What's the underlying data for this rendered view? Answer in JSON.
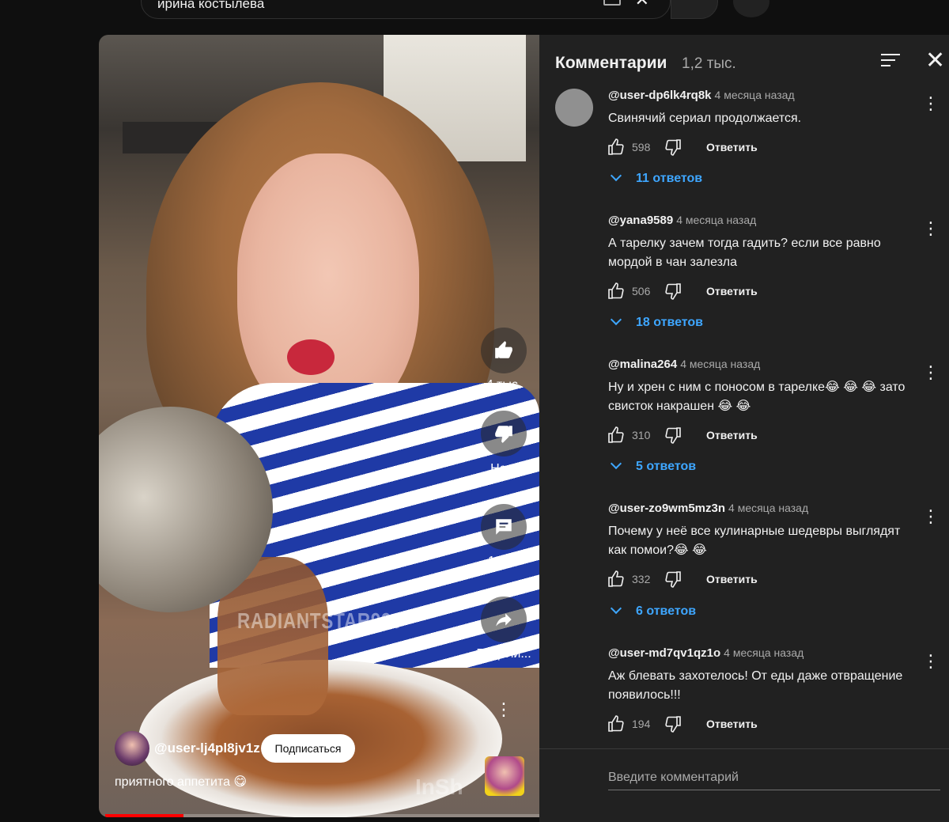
{
  "search": {
    "query": "ирина костылева"
  },
  "video": {
    "watermark": "RADIANTSTAR999",
    "watermark2": "InSh",
    "likes_label": "4 тыс.",
    "dislike_label": "Не...",
    "comments_label": "1 216",
    "share_label": "Подели...",
    "channel": "@user-lj4pl8jv1z",
    "subscribe_label": "Подписаться",
    "caption": "приятного аппетита 😋",
    "progress_fraction": 0.18
  },
  "comments_panel": {
    "title": "Комментарии",
    "count": "1,2 тыс.",
    "input_placeholder": "Введите комментарий",
    "reply_label": "Ответить",
    "items": [
      {
        "user": "@user-dp6lk4rq8k",
        "time": "4 месяца назад",
        "text": "Свинячий сериал продолжается.",
        "likes": "598",
        "replies": "11 ответов"
      },
      {
        "user": "@yana9589",
        "time": "4 месяца назад",
        "text": "А тарелку зачем тогда гадить? если все равно мордой в чан залезла",
        "likes": "506",
        "replies": "18 ответов"
      },
      {
        "user": "@malina264",
        "time": "4 месяца назад",
        "text": "Ну и хрен с ним с поносом в тарелке😂 😂 😂 зато свисток накрашен 😂 😂",
        "likes": "310",
        "replies": "5 ответов"
      },
      {
        "user": "@user-zo9wm5mz3n",
        "time": "4 месяца назад",
        "text": "Почему у неё все кулинарные шедевры выглядят как помои?😂 😂",
        "likes": "332",
        "replies": "6 ответов"
      },
      {
        "user": "@user-md7qv1qz1o",
        "time": "4 месяца назад",
        "text": "Аж блевать захотелось! От еды даже отвращение появилось!!!",
        "likes": "194",
        "replies": ""
      }
    ]
  },
  "colors": {
    "background": "#0f0f0f",
    "panel": "#212121",
    "link": "#3ea6ff",
    "progress": "#ff0000"
  }
}
